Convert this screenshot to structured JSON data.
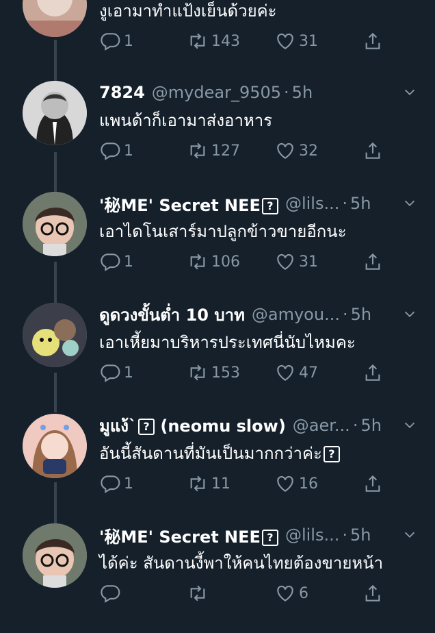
{
  "top_tweet": {
    "text": "งูเอามาทำแป้งเย็นด้วยค่ะ",
    "replies": "1",
    "retweets": "143",
    "likes": "31"
  },
  "tweets": [
    {
      "name": "7824",
      "handle": "@mydear_9505",
      "time": "5h",
      "text": "แพนด้าก็เอามาส่งอาหาร",
      "replies": "1",
      "retweets": "127",
      "likes": "32",
      "avatar": "bw-portrait"
    },
    {
      "name": "'秘ME' Secret NEE",
      "name_box": "?",
      "handle": "@lils...",
      "time": "5h",
      "text": "เอาไดโนเสาร์มาปลูกข้าวขายอีกนะ",
      "replies": "1",
      "retweets": "106",
      "likes": "31",
      "avatar": "glasses-boy"
    },
    {
      "name": "ดูดวงขั้นต่ำ 10 บาท",
      "handle": "@amyou...",
      "time": "5h",
      "text": "เอาเหี้ยมาบริหารประเทศนี่นับไหมคะ",
      "replies": "1",
      "retweets": "153",
      "likes": "47",
      "avatar": "plush-toys"
    },
    {
      "name": "มูแง้`",
      "name_box": "?",
      "name_suffix": "(neomu slow)",
      "handle": "@aer...",
      "time": "5h",
      "text": "อันนี้สันดานที่มันเป็นมากกว่าค่ะ",
      "text_box": "?",
      "replies": "1",
      "retweets": "11",
      "likes": "16",
      "avatar": "girl-selfie"
    },
    {
      "name": "'秘ME' Secret NEE",
      "name_box": "?",
      "handle": "@lils...",
      "time": "5h",
      "text": "ได้ค่ะ สันดานงี้พาให้คนไทยต้องขายหน้า",
      "replies": "",
      "retweets": "",
      "likes": "6",
      "avatar": "glasses-boy"
    }
  ],
  "separator": "·",
  "icons": [
    "reply-icon",
    "retweet-icon",
    "like-icon",
    "share-icon",
    "chevron-down-icon"
  ],
  "colors": {
    "background": "#15202b",
    "muted": "#8899a6",
    "text": "#ffffff",
    "thread_line": "#38444d"
  }
}
